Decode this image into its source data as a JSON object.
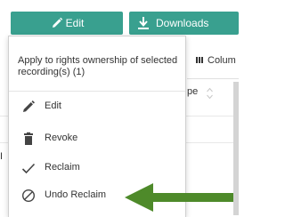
{
  "toolbar": {
    "edit_label": "Edit",
    "downloads_label": "Downloads"
  },
  "background": {
    "columns_label": "Colum",
    "type_header_partial": "pe"
  },
  "dropdown": {
    "header": "Apply to rights ownership of selected recording(s) (1)",
    "items": [
      {
        "label": "Edit",
        "icon": "pencil-icon"
      },
      {
        "label": "Revoke",
        "icon": "trash-icon"
      },
      {
        "label": "Reclaim",
        "icon": "checkmark-icon"
      },
      {
        "label": "Undo Reclaim",
        "icon": "prohibited-icon"
      }
    ]
  },
  "colors": {
    "accent": "#39a08f",
    "arrow": "#4e8a2a",
    "text": "#333333"
  }
}
